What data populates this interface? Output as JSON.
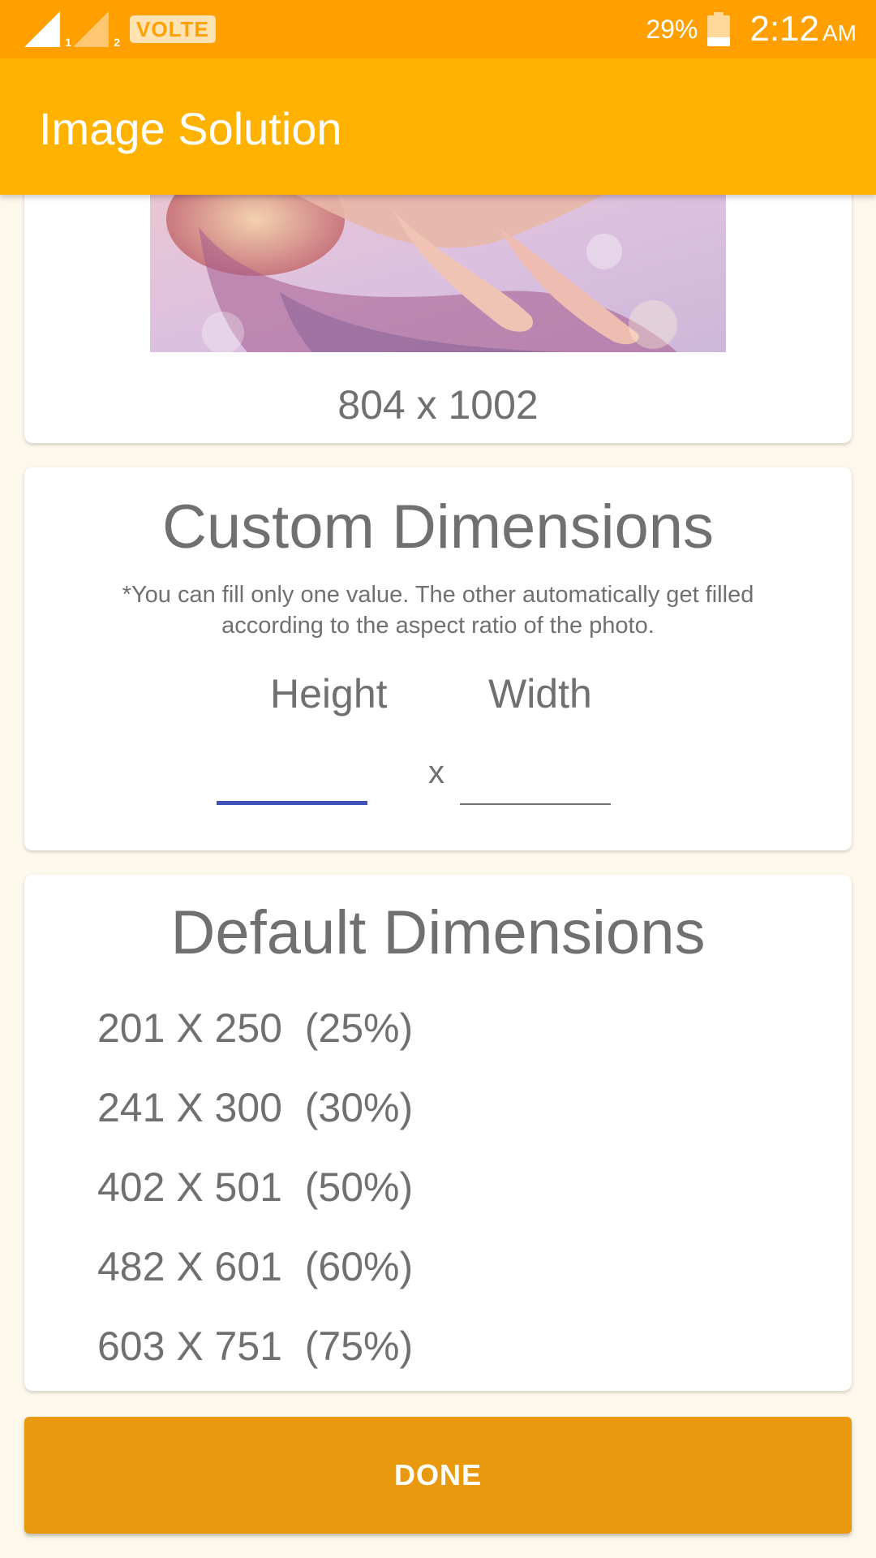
{
  "status_bar": {
    "sim1": "1",
    "sim2": "2",
    "volte": "VOLTE",
    "battery_percent": "29%",
    "battery_level": 0.29,
    "time": "2:12",
    "ampm": "AM"
  },
  "app_bar": {
    "title": "Image Solution"
  },
  "image_card": {
    "dimensions": "804 x 1002"
  },
  "custom": {
    "title": "Custom Dimensions",
    "note": "*You can fill only one value. The other automatically get filled according to the aspect ratio of the photo.",
    "height_label": "Height",
    "width_label": "Width",
    "height_value": "",
    "width_value": "",
    "separator": "x"
  },
  "default": {
    "title": "Default Dimensions",
    "items": [
      {
        "label": "201 X 250  (25%)"
      },
      {
        "label": "241 X 300  (30%)"
      },
      {
        "label": "402 X 501  (50%)"
      },
      {
        "label": "482 X 601  (60%)"
      },
      {
        "label": "603 X 751  (75%)"
      }
    ]
  },
  "done_button": {
    "label": "DONE"
  },
  "colors": {
    "status_bar": "#ffa000",
    "app_bar": "#ffb300",
    "accent_input": "#3f51b5",
    "button": "#e8990d"
  }
}
